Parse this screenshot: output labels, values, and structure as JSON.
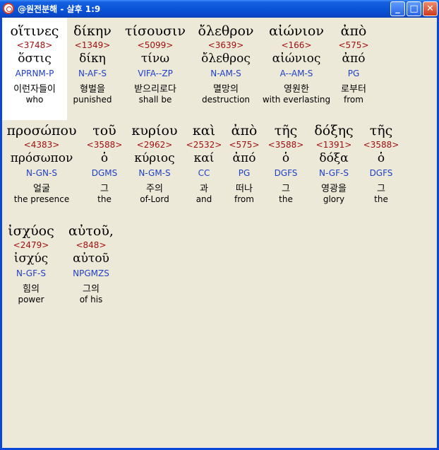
{
  "window": {
    "title": "@원전분해 - 살후 1:9",
    "buttons": {
      "minimize": "_",
      "maximize": "□",
      "close": "✕"
    }
  },
  "rows": [
    [
      {
        "greek": "οἵτινες",
        "strongs": "<3748>",
        "lemma": "ὅστις",
        "parsing": "APRNM-P",
        "korean": "이런자들이",
        "english": "who"
      },
      {
        "greek": "δίκην",
        "strongs": "<1349>",
        "lemma": "δίκη",
        "parsing": "N-AF-S",
        "korean": "형벌을",
        "english": "punished"
      },
      {
        "greek": "τίσουσιν",
        "strongs": "<5099>",
        "lemma": "τίνω",
        "parsing": "VIFA--ZP",
        "korean": "받으리로다",
        "english": "shall be"
      },
      {
        "greek": "ὄλεθρον",
        "strongs": "<3639>",
        "lemma": "ὄλεθρος",
        "parsing": "N-AM-S",
        "korean": "멸망의",
        "english": "destruction"
      },
      {
        "greek": "αἰώνιον",
        "strongs": "<166>",
        "lemma": "αἰώνιος",
        "parsing": "A--AM-S",
        "korean": "영원한",
        "english": "with everlasting"
      },
      {
        "greek": "ἀπὸ",
        "strongs": "<575>",
        "lemma": "ἀπό",
        "parsing": "PG",
        "korean": "로부터",
        "english": "from"
      }
    ],
    [
      {
        "greek": "προσώπου",
        "strongs": "<4383>",
        "lemma": "πρόσωπον",
        "parsing": "N-GN-S",
        "korean": "얼굴",
        "english": "the presence"
      },
      {
        "greek": "τοῦ",
        "strongs": "<3588>",
        "lemma": "ὁ",
        "parsing": "DGMS",
        "korean": "그",
        "english": "the"
      },
      {
        "greek": "κυρίου",
        "strongs": "<2962>",
        "lemma": "κύριος",
        "parsing": "N-GM-S",
        "korean": "주의",
        "english": "of-Lord"
      },
      {
        "greek": "καὶ",
        "strongs": "<2532>",
        "lemma": "καί",
        "parsing": "CC",
        "korean": "과",
        "english": "and"
      },
      {
        "greek": "ἀπὸ",
        "strongs": "<575>",
        "lemma": "ἀπό",
        "parsing": "PG",
        "korean": "떠나",
        "english": "from"
      },
      {
        "greek": "τῆς",
        "strongs": "<3588>",
        "lemma": "ὁ",
        "parsing": "DGFS",
        "korean": "그",
        "english": "the"
      },
      {
        "greek": "δόξης",
        "strongs": "<1391>",
        "lemma": "δόξα",
        "parsing": "N-GF-S",
        "korean": "영광을",
        "english": "glory"
      },
      {
        "greek": "τῆς",
        "strongs": "<3588>",
        "lemma": "ὁ",
        "parsing": "DGFS",
        "korean": "그",
        "english": "the"
      }
    ],
    [
      {
        "greek": "ἰσχύος",
        "strongs": "<2479>",
        "lemma": "ἰσχύς",
        "parsing": "N-GF-S",
        "korean": "힘의",
        "english": "power"
      },
      {
        "greek": "αὐτοῦ,",
        "strongs": "<848>",
        "lemma": "αὐτοῦ",
        "parsing": "NPGMZS",
        "korean": "그의",
        "english": "of his"
      }
    ]
  ]
}
